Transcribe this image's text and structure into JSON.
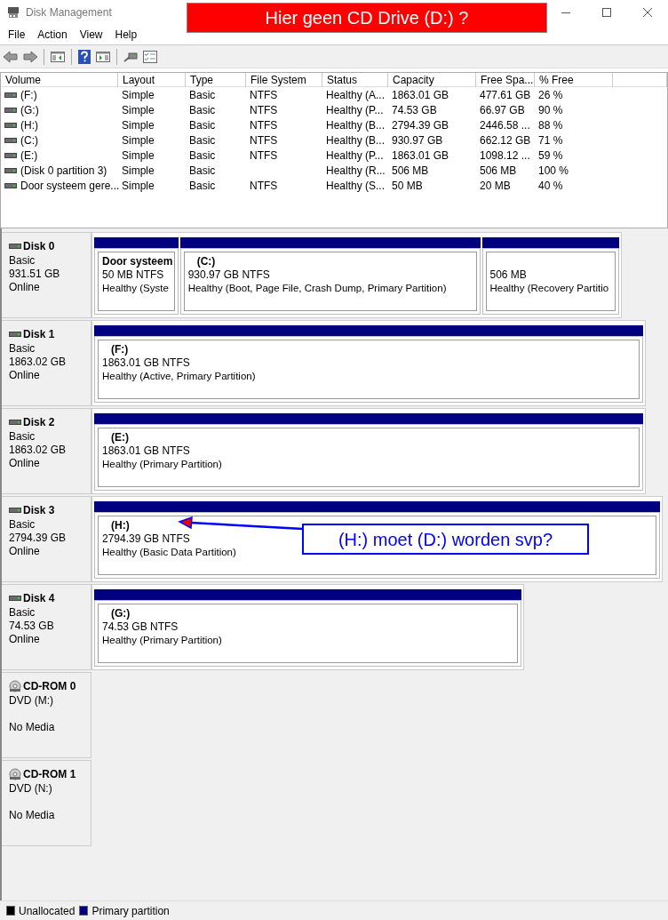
{
  "window": {
    "title": "Disk Management"
  },
  "annotation_banner": {
    "text": "Hier geen CD Drive (D:) ?"
  },
  "menu": [
    "File",
    "Action",
    "View",
    "Help"
  ],
  "table": {
    "columns": [
      "Volume",
      "Layout",
      "Type",
      "File System",
      "Status",
      "Capacity",
      "Free Spa...",
      "% Free"
    ],
    "rows": [
      {
        "cells": [
          "(F:)",
          "Simple",
          "Basic",
          "NTFS",
          "Healthy (A...",
          "1863.01 GB",
          "477.61 GB",
          "26 %"
        ]
      },
      {
        "cells": [
          "(G:)",
          "Simple",
          "Basic",
          "NTFS",
          "Healthy (P...",
          "74.53 GB",
          "66.97 GB",
          "90 %"
        ]
      },
      {
        "cells": [
          "(H:)",
          "Simple",
          "Basic",
          "NTFS",
          "Healthy (B...",
          "2794.39 GB",
          "2446.58 ...",
          "88 %"
        ]
      },
      {
        "cells": [
          "(C:)",
          "Simple",
          "Basic",
          "NTFS",
          "Healthy (B...",
          "930.97 GB",
          "662.12 GB",
          "71 %"
        ]
      },
      {
        "cells": [
          "(E:)",
          "Simple",
          "Basic",
          "NTFS",
          "Healthy (P...",
          "1863.01 GB",
          "1098.12 ...",
          "59 %"
        ]
      },
      {
        "cells": [
          "(Disk 0 partition 3)",
          "Simple",
          "Basic",
          "",
          "Healthy (R...",
          "506 MB",
          "506 MB",
          "100 %"
        ]
      },
      {
        "cells": [
          "Door systeem gere...",
          "Simple",
          "Basic",
          "NTFS",
          "Healthy (S...",
          "50 MB",
          "20 MB",
          "40 %"
        ]
      }
    ]
  },
  "disks": [
    {
      "kind": "disk",
      "name": "Disk 0",
      "type": "Basic",
      "size": "931.51 GB",
      "status": "Online",
      "partitions": [
        {
          "label": "Door systeem",
          "size": "50 MB NTFS",
          "health": "Healthy (Syste"
        },
        {
          "label": "(C:)",
          "size": "930.97 GB NTFS",
          "health": "Healthy (Boot, Page File, Crash Dump, Primary Partition)"
        },
        {
          "size": "506 MB",
          "health": "Healthy (Recovery Partitio"
        }
      ]
    },
    {
      "kind": "disk",
      "name": "Disk 1",
      "type": "Basic",
      "size": "1863.02 GB",
      "status": "Online",
      "partitions": [
        {
          "label": "(F:)",
          "size": "1863.01 GB NTFS",
          "health": "Healthy (Active, Primary Partition)"
        }
      ]
    },
    {
      "kind": "disk",
      "name": "Disk 2",
      "type": "Basic",
      "size": "1863.02 GB",
      "status": "Online",
      "partitions": [
        {
          "label": "(E:)",
          "size": "1863.01 GB NTFS",
          "health": "Healthy (Primary Partition)"
        }
      ]
    },
    {
      "kind": "disk",
      "name": "Disk 3",
      "type": "Basic",
      "size": "2794.39 GB",
      "status": "Online",
      "partitions": [
        {
          "label": "(H:)",
          "size": "2794.39 GB NTFS",
          "health": "Healthy (Basic Data Partition)"
        }
      ]
    },
    {
      "kind": "disk",
      "name": "Disk 4",
      "type": "Basic",
      "size": "74.53 GB",
      "status": "Online",
      "partitions": [
        {
          "label": "(G:)",
          "size": "74.53 GB NTFS",
          "health": "Healthy (Primary Partition)"
        }
      ]
    },
    {
      "kind": "cdrom",
      "name": "CD-ROM 0",
      "type": "DVD (M:)",
      "status": "No Media"
    },
    {
      "kind": "cdrom",
      "name": "CD-ROM 1",
      "type": "DVD (N:)",
      "status": "No Media"
    }
  ],
  "annotation_callout": {
    "text": "(H:) moet (D:) worden svp?"
  },
  "legend": [
    {
      "label": "Unallocated",
      "color": "#000000"
    },
    {
      "label": "Primary partition",
      "color": "#000080"
    }
  ]
}
